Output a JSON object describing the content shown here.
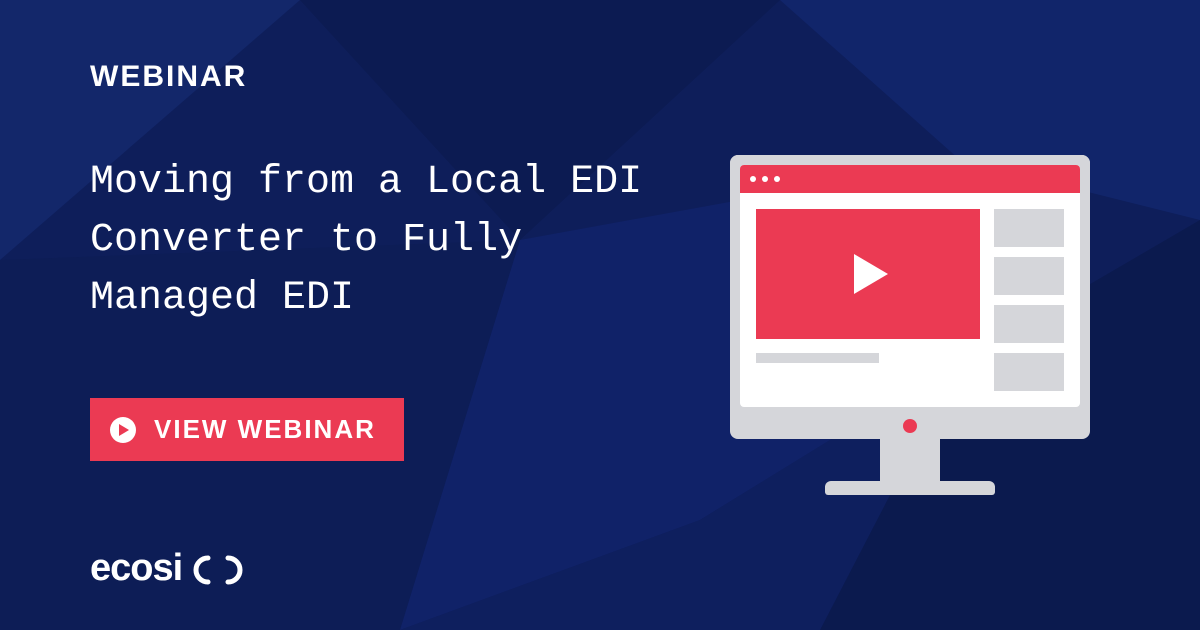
{
  "eyebrow": "WEBINAR",
  "headline": "Moving from a Local EDI Converter to Fully Managed EDI",
  "cta_label": "VIEW WEBINAR",
  "logo_text": "ecosio",
  "colors": {
    "background": "#0e1e5a",
    "accent": "#eb3a53",
    "text": "#ffffff",
    "neutral": "#d5d6da"
  },
  "illustration": {
    "type": "monitor-with-video-player",
    "sidebar_item_count": 4
  }
}
